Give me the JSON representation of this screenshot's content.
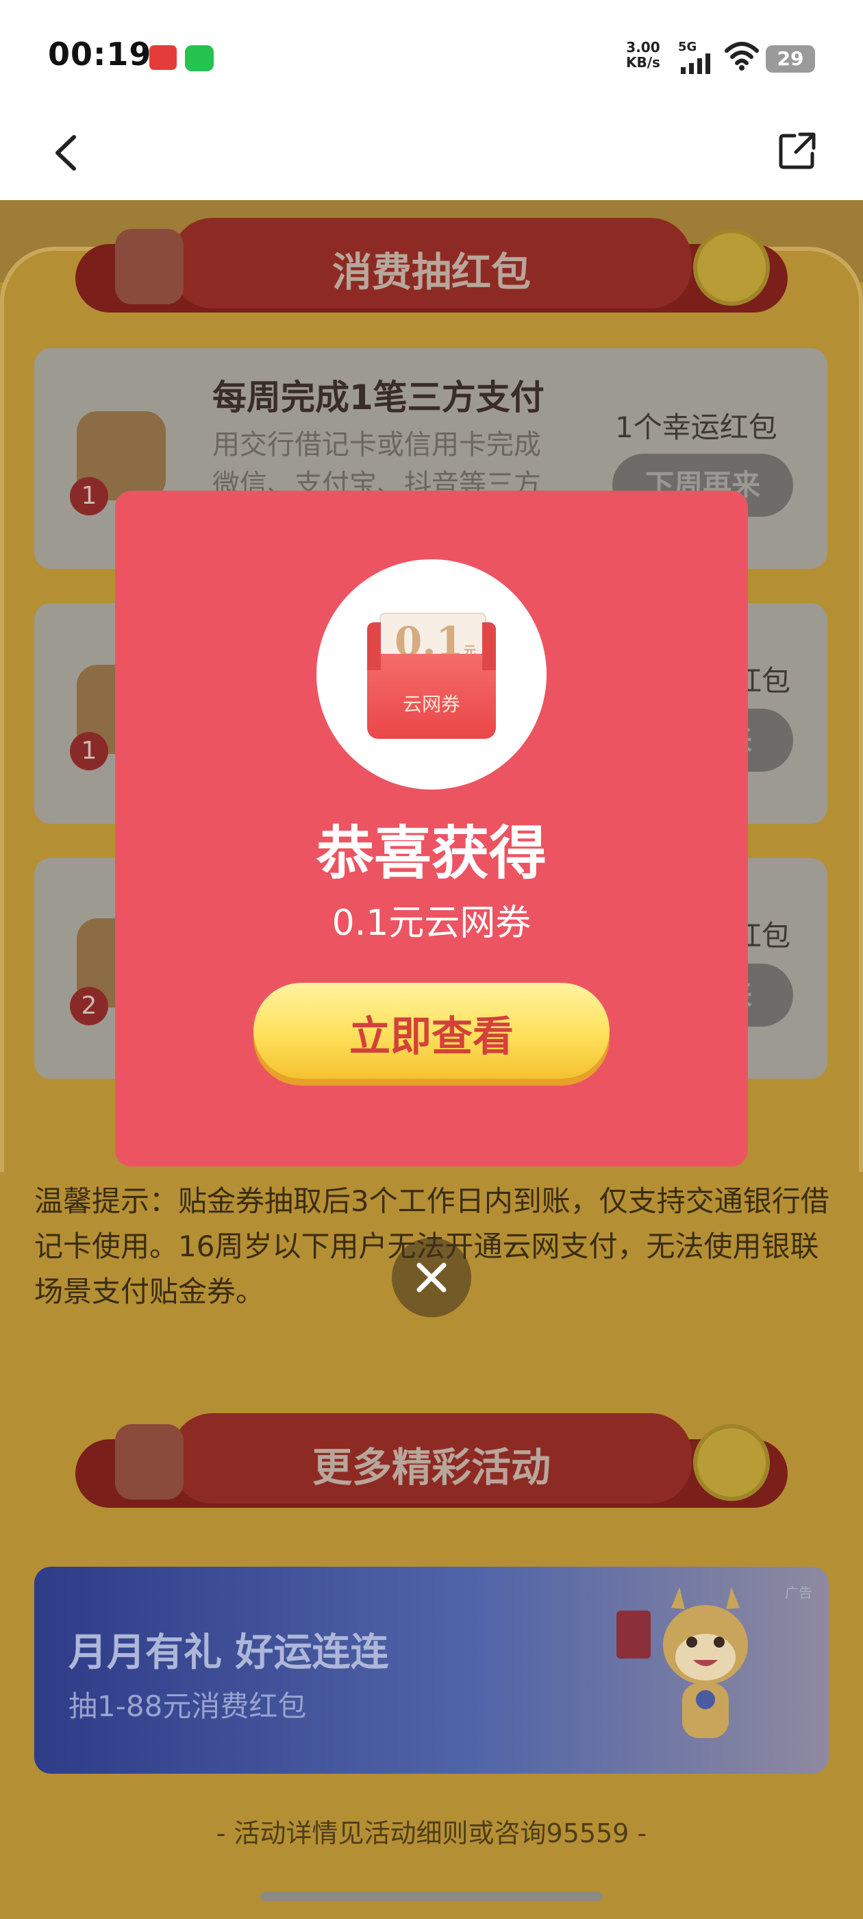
{
  "status_bar": {
    "time": "00:19",
    "net_speed_top": "3.00",
    "net_speed_bottom": "KB/s",
    "network_type": "5G",
    "battery": "29"
  },
  "section1": {
    "title": "消费抽红包",
    "tasks": [
      {
        "badge": "1",
        "title": "每周完成1笔三方支付",
        "desc_line1": "用交行借记卡或信用卡完成",
        "desc_line2": "微信、支付宝、抖音等三方",
        "reward": "1个幸运红包",
        "button": "下周再来"
      },
      {
        "badge": "1",
        "reward_tail": "红包",
        "button_tail": "来"
      },
      {
        "badge": "2",
        "reward_tail": "红包",
        "button_tail": "来"
      }
    ]
  },
  "tip": "温馨提示：贴金券抽取后3个工作日内到账，仅支持交通银行借记卡使用。16周岁以下用户无法开通云网支付，无法使用银联场景支付贴金券。",
  "section2": {
    "title": "更多精彩活动"
  },
  "ad": {
    "title": "月月有礼 好运连连",
    "subtitle": "抽1-88元消费红包",
    "tag": "广告"
  },
  "footer": "- 活动详情见活动细则或咨询95559 -",
  "modal": {
    "prize_amount": "0.1",
    "prize_unit": "元",
    "prize_label": "云网券",
    "title": "恭喜获得",
    "subtitle": "0.1元云网券",
    "button": "立即查看"
  },
  "colors": {
    "modal_bg": "#ec5462",
    "button_yellow": "#fde05a",
    "button_text": "#d4413a",
    "overlay_bg": "#b58f33"
  },
  "icons": [
    "back-icon",
    "share-icon",
    "close-icon",
    "signal-icon",
    "wifi-icon",
    "battery-icon"
  ]
}
